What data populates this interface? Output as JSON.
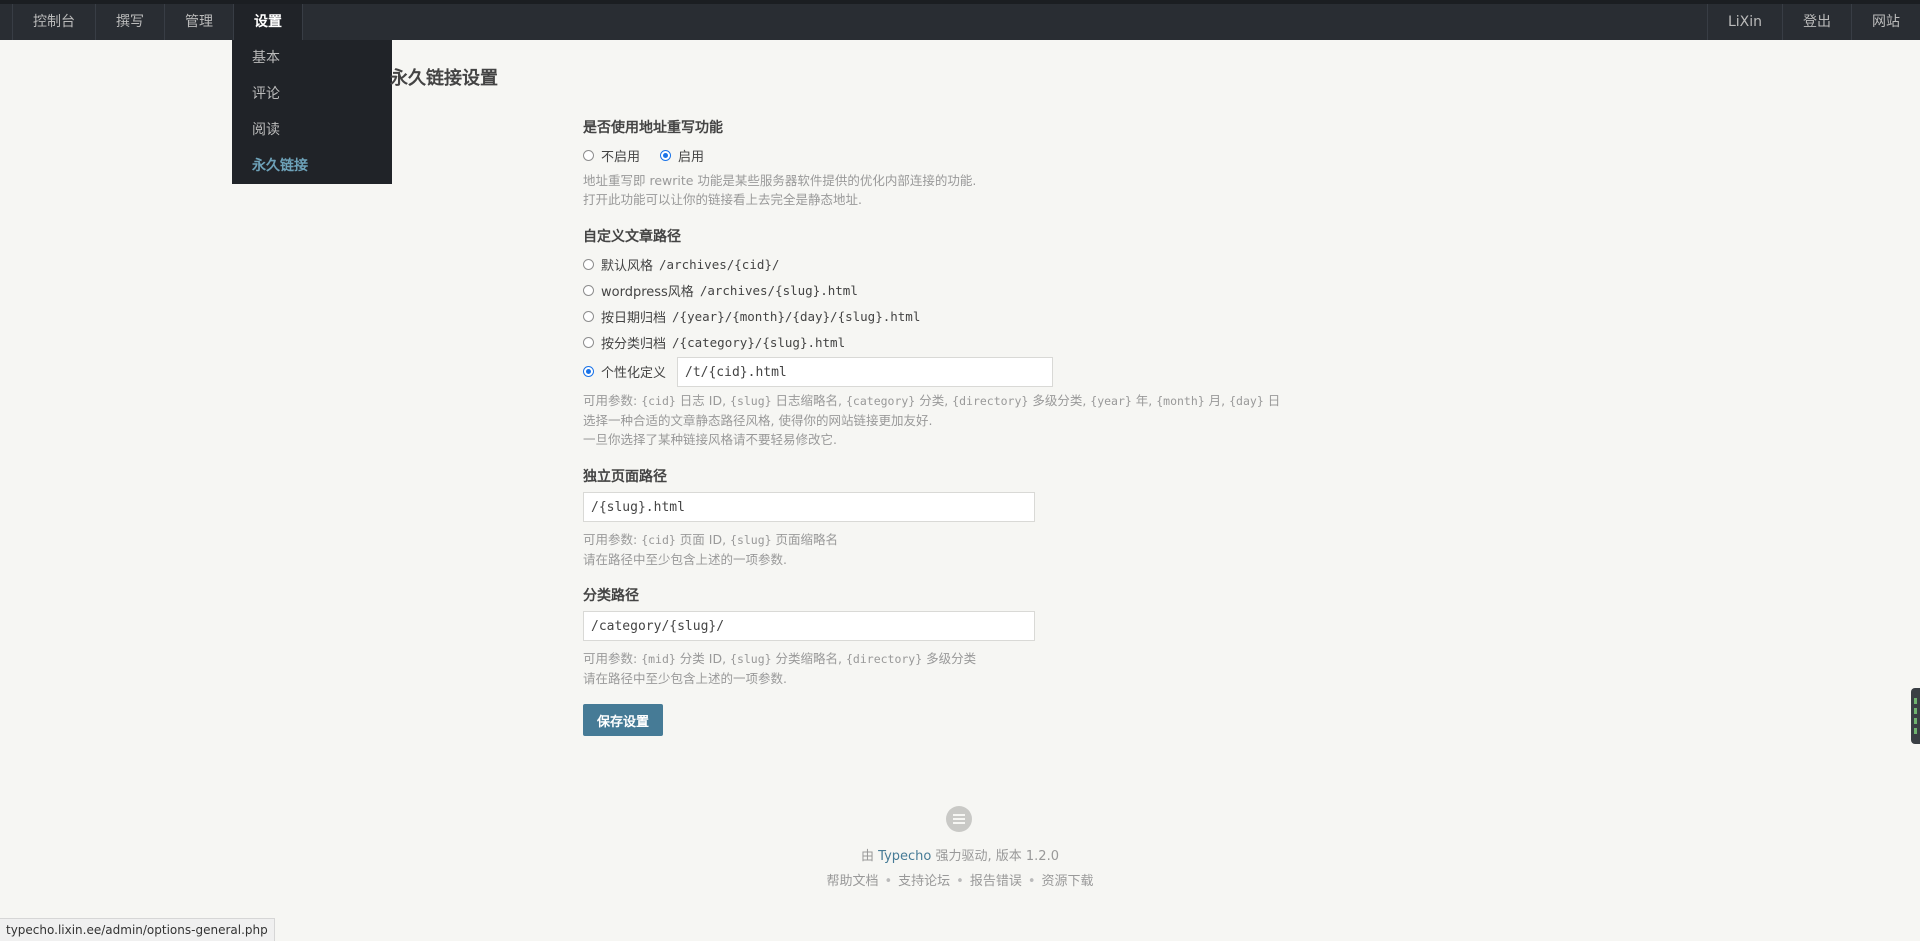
{
  "topbar": {
    "left_items": [
      {
        "label": "控制台"
      },
      {
        "label": "撰写"
      },
      {
        "label": "管理"
      },
      {
        "label": "设置"
      }
    ],
    "right_items": [
      {
        "label": "LiXin"
      },
      {
        "label": "登出"
      },
      {
        "label": "网站"
      }
    ]
  },
  "dropdown": {
    "items": [
      {
        "label": "基本"
      },
      {
        "label": "评论"
      },
      {
        "label": "阅读"
      },
      {
        "label": "永久链接"
      }
    ]
  },
  "page": {
    "title": "永久链接设置"
  },
  "rewrite": {
    "label": "是否使用地址重写功能",
    "options": [
      "不启用",
      "启用"
    ],
    "selected": "启用",
    "desc_line1": "地址重写即 rewrite 功能是某些服务器软件提供的优化内部连接的功能.",
    "desc_line2": "打开此功能可以让你的链接看上去完全是静态地址."
  },
  "post_path": {
    "label": "自定义文章路径",
    "options": [
      {
        "name": "默认风格",
        "pattern": "/archives/{cid}/"
      },
      {
        "name": "wordpress风格",
        "pattern": "/archives/{slug}.html"
      },
      {
        "name": "按日期归档",
        "pattern": "/{year}/{month}/{day}/{slug}.html"
      },
      {
        "name": "按分类归档",
        "pattern": "/{category}/{slug}.html"
      },
      {
        "name": "个性化定义",
        "pattern": ""
      }
    ],
    "selected": "个性化定义",
    "custom_value": "/t/{cid}.html",
    "params": {
      "prefix": "可用参数: ",
      "cid": "{cid}",
      "cid_text": " 日志 ID, ",
      "slug": "{slug}",
      "slug_text": " 日志缩略名, ",
      "category": "{category}",
      "category_text": " 分类, ",
      "directory": "{directory}",
      "directory_text": " 多级分类, ",
      "year": "{year}",
      "year_text": " 年, ",
      "month": "{month}",
      "month_text": " 月, ",
      "day": "{day}",
      "day_text": " 日"
    },
    "desc_line2": "选择一种合适的文章静态路径风格, 使得你的网站链接更加友好.",
    "desc_line3": "一旦你选择了某种链接风格请不要轻易修改它."
  },
  "page_path": {
    "label": "独立页面路径",
    "value": "/{slug}.html",
    "params": {
      "prefix": "可用参数: ",
      "cid": "{cid}",
      "cid_text": " 页面 ID, ",
      "slug": "{slug}",
      "slug_text": " 页面缩略名"
    },
    "desc_line2": "请在路径中至少包含上述的一项参数."
  },
  "category_path": {
    "label": "分类路径",
    "value": "/category/{slug}/",
    "params": {
      "prefix": "可用参数: ",
      "mid": "{mid}",
      "mid_text": " 分类 ID, ",
      "slug": "{slug}",
      "slug_text": " 分类缩略名, ",
      "directory": "{directory}",
      "directory_text": " 多级分类"
    },
    "desc_line2": "请在路径中至少包含上述的一项参数."
  },
  "save_label": "保存设置",
  "footer": {
    "credit_prefix": "由 ",
    "credit_link": "Typecho",
    "credit_suffix": " 强力驱动, 版本 1.2.0",
    "links": [
      "帮助文档",
      "支持论坛",
      "报告错误",
      "资源下载"
    ],
    "separator": "•"
  },
  "status_url": "typecho.lixin.ee/admin/options-general.php",
  "colors": {
    "topbar": "#292d33",
    "accent": "#467b96",
    "dropdown_current": "#6da1b8",
    "radio_checked": "#1a73e8"
  },
  "icons": {
    "footer_logo": "typecho-logo-icon"
  }
}
